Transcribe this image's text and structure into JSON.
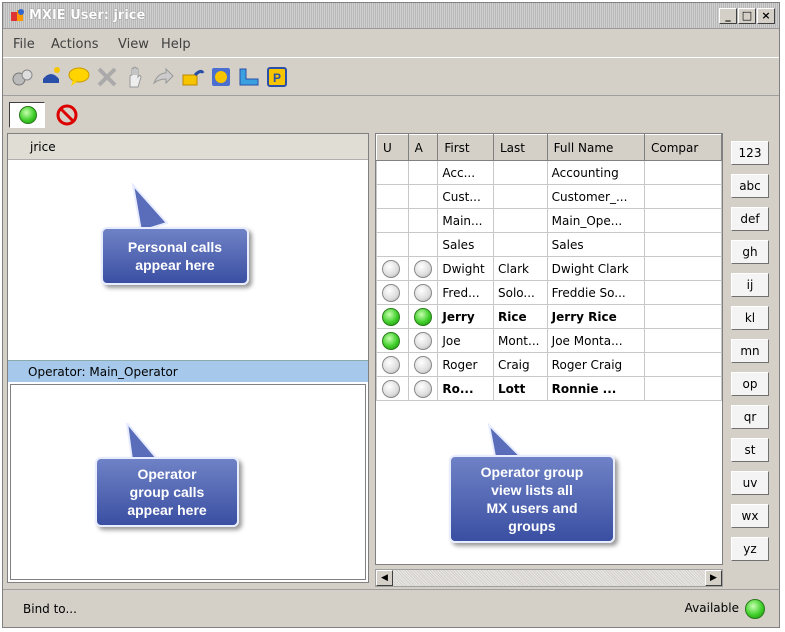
{
  "window": {
    "title": "MXIE User: jrice",
    "min": "_",
    "max": "□",
    "close": "×"
  },
  "menu": [
    "File",
    "Actions",
    "View",
    "Help"
  ],
  "toolbar_icons": [
    "dial-icon",
    "phone-ring-icon",
    "chat-icon",
    "hangup-icon",
    "hold-icon",
    "transfer-icon",
    "voicemail-icon",
    "contacts-icon",
    "conference-icon",
    "park-icon"
  ],
  "left": {
    "user_header": "jrice",
    "operator_header": "Operator: Main_Operator"
  },
  "table": {
    "columns": [
      "U",
      "A",
      "First",
      "Last",
      "Full Name",
      "Compar"
    ],
    "rows": [
      {
        "u": "",
        "a": "",
        "first": "Acc...",
        "last": "",
        "full": "Accounting",
        "bold": false
      },
      {
        "u": "",
        "a": "",
        "first": "Cust...",
        "last": "",
        "full": "Customer_...",
        "bold": false
      },
      {
        "u": "",
        "a": "",
        "first": "Main...",
        "last": "",
        "full": "Main_Ope...",
        "bold": false
      },
      {
        "u": "",
        "a": "",
        "first": "Sales",
        "last": "",
        "full": "Sales",
        "bold": false
      },
      {
        "u": "off",
        "a": "off",
        "first": "Dwight",
        "last": "Clark",
        "full": "Dwight Clark",
        "bold": false
      },
      {
        "u": "off",
        "a": "off",
        "first": "Fred...",
        "last": "Solo...",
        "full": "Freddie So...",
        "bold": false
      },
      {
        "u": "on",
        "a": "on",
        "first": "Jerry",
        "last": "Rice",
        "full": "Jerry Rice",
        "bold": true
      },
      {
        "u": "on",
        "a": "off",
        "first": "Joe",
        "last": "Mont...",
        "full": "Joe Monta...",
        "bold": false
      },
      {
        "u": "off",
        "a": "off",
        "first": "Roger",
        "last": "Craig",
        "full": "Roger Craig",
        "bold": false
      },
      {
        "u": "off",
        "a": "off",
        "first": "Ro...",
        "last": "Lott",
        "full": "Ronnie ...",
        "bold": true
      }
    ]
  },
  "alpha_buttons": [
    "123",
    "abc",
    "def",
    "gh",
    "ij",
    "kl",
    "mn",
    "op",
    "qr",
    "st",
    "uv",
    "wx",
    "yz"
  ],
  "callouts": {
    "personal": "Personal calls\nappear here",
    "operator": "Operator\ngroup calls\nappear here",
    "group_view": "Operator group\nview lists all\nMX users and\ngroups"
  },
  "footer": {
    "bind": "Bind to...",
    "status": "Available"
  },
  "colors": {
    "available": "#3fcf2a",
    "callout": "#4a5fb0",
    "operator_header": "#a6c8ea"
  }
}
